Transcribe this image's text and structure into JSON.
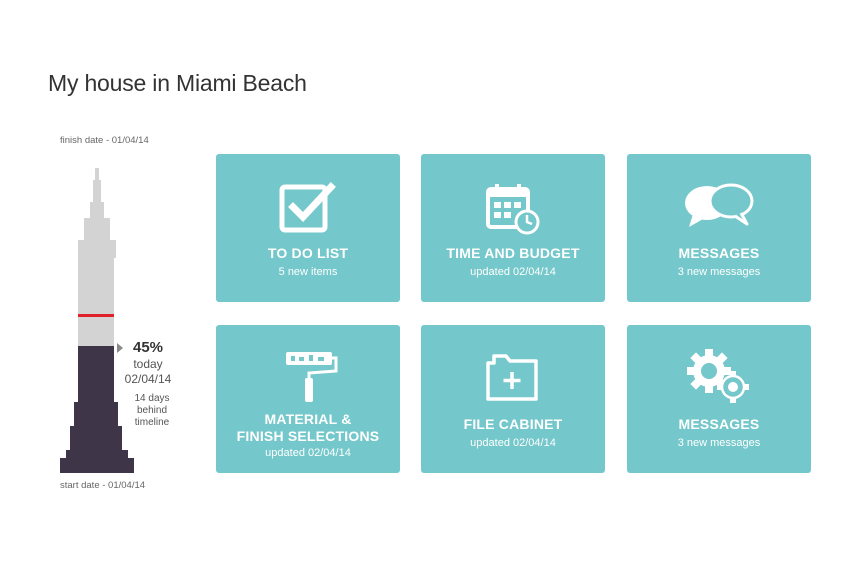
{
  "page": {
    "title": "My house in Miami Beach"
  },
  "timeline": {
    "finish_label": "finish date - 01/04/14",
    "start_label": "start date - 01/04/14",
    "progress_percent": 45,
    "progress_text": "45%",
    "today_label": "today",
    "today_date": "02/04/14",
    "behind_text": "14 days behind timeline",
    "colors": {
      "complete": "#3e3548",
      "remaining": "#d3d3d3",
      "marker": "#e0202a"
    }
  },
  "tiles": [
    {
      "title": "TO DO LIST",
      "subtitle": "5 new items",
      "icon": "checkbox-icon"
    },
    {
      "title": "TIME AND BUDGET",
      "subtitle": "updated 02/04/14",
      "icon": "calendar-clock-icon"
    },
    {
      "title": "MESSAGES",
      "subtitle": "3 new messages",
      "icon": "chat-bubbles-icon"
    },
    {
      "title_line1": "MATERIAL &",
      "title_line2": "FINISH SELECTIONS",
      "subtitle": "updated 02/04/14",
      "icon": "paint-roller-icon"
    },
    {
      "title": "FILE CABINET",
      "subtitle": "updated 02/04/14",
      "icon": "folder-add-icon"
    },
    {
      "title": "MESSAGES",
      "subtitle": "3 new messages",
      "icon": "gears-icon"
    }
  ],
  "colors": {
    "tile": "#74c7ca",
    "tile_text": "#ffffff"
  }
}
